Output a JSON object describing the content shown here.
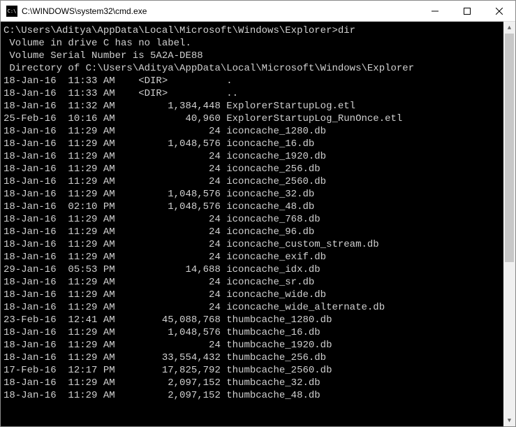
{
  "title": "C:\\WINDOWS\\system32\\cmd.exe",
  "prompt": "C:\\Users\\Aditya\\AppData\\Local\\Microsoft\\Windows\\Explorer>dir",
  "vol1": " Volume in drive C has no label.",
  "vol2": " Volume Serial Number is 5A2A-DE88",
  "dirof": " Directory of C:\\Users\\Aditya\\AppData\\Local\\Microsoft\\Windows\\Explorer",
  "dirmark": "<DIR>",
  "entries": [
    {
      "date": "18-Jan-16",
      "time": "11:33 AM",
      "size": "<DIR>",
      "name": "."
    },
    {
      "date": "18-Jan-16",
      "time": "11:33 AM",
      "size": "<DIR>",
      "name": ".."
    },
    {
      "date": "18-Jan-16",
      "time": "11:32 AM",
      "size": "1,384,448",
      "name": "ExplorerStartupLog.etl"
    },
    {
      "date": "25-Feb-16",
      "time": "10:16 AM",
      "size": "40,960",
      "name": "ExplorerStartupLog_RunOnce.etl"
    },
    {
      "date": "18-Jan-16",
      "time": "11:29 AM",
      "size": "24",
      "name": "iconcache_1280.db"
    },
    {
      "date": "18-Jan-16",
      "time": "11:29 AM",
      "size": "1,048,576",
      "name": "iconcache_16.db"
    },
    {
      "date": "18-Jan-16",
      "time": "11:29 AM",
      "size": "24",
      "name": "iconcache_1920.db"
    },
    {
      "date": "18-Jan-16",
      "time": "11:29 AM",
      "size": "24",
      "name": "iconcache_256.db"
    },
    {
      "date": "18-Jan-16",
      "time": "11:29 AM",
      "size": "24",
      "name": "iconcache_2560.db"
    },
    {
      "date": "18-Jan-16",
      "time": "11:29 AM",
      "size": "1,048,576",
      "name": "iconcache_32.db"
    },
    {
      "date": "18-Jan-16",
      "time": "02:10 PM",
      "size": "1,048,576",
      "name": "iconcache_48.db"
    },
    {
      "date": "18-Jan-16",
      "time": "11:29 AM",
      "size": "24",
      "name": "iconcache_768.db"
    },
    {
      "date": "18-Jan-16",
      "time": "11:29 AM",
      "size": "24",
      "name": "iconcache_96.db"
    },
    {
      "date": "18-Jan-16",
      "time": "11:29 AM",
      "size": "24",
      "name": "iconcache_custom_stream.db"
    },
    {
      "date": "18-Jan-16",
      "time": "11:29 AM",
      "size": "24",
      "name": "iconcache_exif.db"
    },
    {
      "date": "29-Jan-16",
      "time": "05:53 PM",
      "size": "14,688",
      "name": "iconcache_idx.db"
    },
    {
      "date": "18-Jan-16",
      "time": "11:29 AM",
      "size": "24",
      "name": "iconcache_sr.db"
    },
    {
      "date": "18-Jan-16",
      "time": "11:29 AM",
      "size": "24",
      "name": "iconcache_wide.db"
    },
    {
      "date": "18-Jan-16",
      "time": "11:29 AM",
      "size": "24",
      "name": "iconcache_wide_alternate.db"
    },
    {
      "date": "23-Feb-16",
      "time": "12:41 AM",
      "size": "45,088,768",
      "name": "thumbcache_1280.db"
    },
    {
      "date": "18-Jan-16",
      "time": "11:29 AM",
      "size": "1,048,576",
      "name": "thumbcache_16.db"
    },
    {
      "date": "18-Jan-16",
      "time": "11:29 AM",
      "size": "24",
      "name": "thumbcache_1920.db"
    },
    {
      "date": "18-Jan-16",
      "time": "11:29 AM",
      "size": "33,554,432",
      "name": "thumbcache_256.db"
    },
    {
      "date": "17-Feb-16",
      "time": "12:17 PM",
      "size": "17,825,792",
      "name": "thumbcache_2560.db"
    },
    {
      "date": "18-Jan-16",
      "time": "11:29 AM",
      "size": "2,097,152",
      "name": "thumbcache_32.db"
    },
    {
      "date": "18-Jan-16",
      "time": "11:29 AM",
      "size": "2,097,152",
      "name": "thumbcache_48.db"
    }
  ]
}
